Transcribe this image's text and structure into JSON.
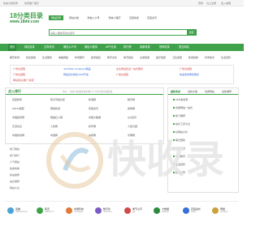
{
  "topbar": {
    "welcome": "快速分类目录",
    "ad": "免费推广展示",
    "login": "登录",
    "register": "马上注册",
    "favorite": "加入收藏"
  },
  "logo": {
    "line1": "18分类目录",
    "line2": "www.18dir.com"
  },
  "tabs": [
    {
      "label": "网站目录",
      "active": true
    },
    {
      "label": "网站文章",
      "active": false
    },
    {
      "label": "微信公众号",
      "active": false
    },
    {
      "label": "微信小程序",
      "active": false
    },
    {
      "label": "百度热搜",
      "active": false
    },
    {
      "label": "百度资讯",
      "active": false
    }
  ],
  "search": {
    "placeholder": "请输入要搜索的关键字",
    "button": "搜索"
  },
  "nav": {
    "items": [
      "首页",
      "网站目录",
      "文章资讯",
      "微信公众号",
      "微信小程序",
      "APP应用",
      "排行榜",
      "最新收录",
      "快审收录",
      "提交网站"
    ]
  },
  "categories": [
    "娱乐休闲",
    "综合其他",
    "生活服务",
    "电脑网络",
    "休闲娱乐",
    "政府组织",
    "教育文化",
    "体育健身",
    "交通旅游",
    "医疗健康",
    "卫生健康",
    "新闻媒体",
    "科学技术",
    "生活百科"
  ],
  "announce": {
    "items": [
      "广告位招租",
      "JuzhiWeb wordpress精品",
      "企业网站建设一站式服务",
      "广告位招租",
      "广告位招租",
      "网站优化排名/APP开发",
      "广告位招租",
      "快速收录审核服务",
      "网站建设/推广/运营"
    ]
  },
  "popular": {
    "title": "点入排行",
    "note": "单价: 一次性价格/收录快审/推广/广告位出售/友情链接",
    "sites": [
      "百度搜索",
      "知乎问答社区",
      "新浪网",
      "腾讯网",
      "SOHU搜狐",
      "网易新闻",
      "凤凰资讯",
      "搜狗网",
      "中国政府网",
      "网络红人网",
      "中国大数据",
      "QQ空间",
      "天涯论坛",
      "人民网",
      "新华网",
      "人民日报",
      "中国新闻网",
      "中国网",
      "央视网",
      "光明网"
    ]
  },
  "right_panel": {
    "tabs": [
      "最新收录",
      "最新文章",
      "优质网站",
      "最新推荐"
    ],
    "items": [
      "18分类目录",
      "优质网站一站式",
      "热门推荐",
      "站长工具大全",
      "好网站分享",
      "每日更新",
      "资源导航",
      "学习教育",
      "生活百科",
      "精选推荐"
    ]
  },
  "hotlist": [
    "热门网站",
    "热门排行",
    "人气网站",
    "热搜榜单",
    "新站推荐",
    "站长推荐",
    "网站大全"
  ],
  "watermark": "快收录",
  "footer_cards": [
    {
      "name": "蓝猫",
      "sub": "NatsumiCup",
      "color": "#4aa3d9"
    },
    {
      "name": "晴天",
      "sub": "18dir.com",
      "color": "#3fa14a"
    },
    {
      "name": "中国科技",
      "sub": "zhongkeji",
      "color": "#e07b39"
    },
    {
      "name": "数字化",
      "sub": "shuzihua",
      "color": "#7a5cc4"
    },
    {
      "name": "季节之声",
      "sub": "jijie",
      "color": "#d04a4a"
    },
    {
      "name": "大数据",
      "sub": "dashuju",
      "color": "#2e8b3c"
    },
    {
      "name": "百度站长",
      "sub": "baidu",
      "color": "#3a6fd9"
    },
    {
      "name": "网络",
      "sub": "wangluo",
      "color": "#c9a23a"
    }
  ]
}
